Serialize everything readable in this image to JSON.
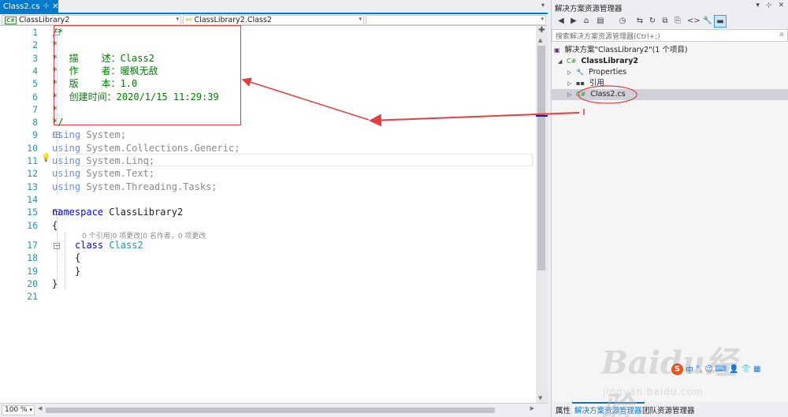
{
  "editor": {
    "tab_label": "Class2.cs",
    "tab_pin": "⊹",
    "tab_close": "✕",
    "tab_overflow": "▾",
    "nav_project": "ClassLibrary2",
    "nav_project_icon": "C#",
    "nav_type": "ClassLibrary2.Class2",
    "nav_member": "",
    "zoom_level": "100 %",
    "line_numbers": [
      "1",
      "2",
      "3",
      "4",
      "5",
      "6",
      "7",
      "8",
      "9",
      "10",
      "11",
      "12",
      "13",
      "14",
      "15",
      "16",
      "17",
      "18",
      "19",
      "20",
      "21"
    ],
    "codelens_text": "0 个引用|0 项更改|0 名作者，0 项更改",
    "code": {
      "l1": "/*",
      "l2": "*",
      "l3": "*  描    述：Class2",
      "l4": "*  作    者：暖枫无敌",
      "l5": "*  版    本：1.0",
      "l6": "*  创建时间：2020/1/15 11:29:39",
      "l7": "*",
      "l8": "*/",
      "using_kw": "using",
      "l9_ns": " System;",
      "l10_ns": " System.Collections.Generic;",
      "l11_ns": " System.Linq;",
      "l12_ns": " System.Text;",
      "l13_ns": " System.Threading.Tasks;",
      "namespace_kw": "namespace",
      "l15_name": " ClassLibrary2",
      "l16": "{",
      "class_kw": "class",
      "l17_name": " Class2",
      "l18": "{",
      "l19": "}",
      "l20": "}"
    }
  },
  "solution_explorer": {
    "title": "解决方案资源管理器",
    "title_buttons": [
      "▾",
      "⊹",
      "✕"
    ],
    "search_placeholder": "搜索解决方案资源管理器(Ctrl+;)",
    "search_icon": "⌕",
    "toolbar_icons": [
      "◀",
      "▶",
      "⌂",
      "▤",
      "◷",
      "⇆",
      "↻",
      "⧉",
      "⎘",
      "<>",
      "🔧",
      "▬"
    ],
    "tree": {
      "solution": "解决方案\"ClassLibrary2\"(1 个项目)",
      "project": "ClassLibrary2",
      "properties": "Properties",
      "references": "引用",
      "file": "Class2.cs"
    },
    "bottom_tabs": [
      "属性",
      "解决方案资源管理器",
      "团队资源管理器"
    ]
  },
  "watermark": {
    "big": "Baidu经验",
    "small": "jingyan.baidu.com"
  },
  "ime": {
    "s": "S",
    "items": [
      "中",
      "°,",
      "☺",
      "⌨",
      "👤",
      "👕",
      "▦"
    ]
  },
  "colors": {
    "accent": "#007acc",
    "comment": "#008000",
    "keyword": "#0000ff",
    "type": "#2b91af",
    "annotation": "#e04040"
  }
}
